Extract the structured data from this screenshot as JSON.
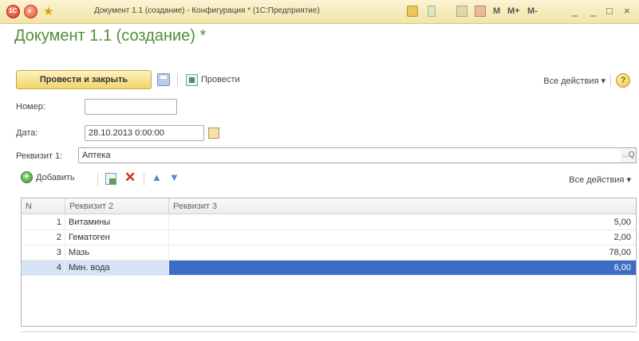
{
  "titlebar": {
    "title": "Документ 1.1 (создание) - Конфигурация * (1С:Предприятие)",
    "logo": "1С",
    "mem_buttons": [
      "M",
      "M+",
      "M-"
    ],
    "window_controls": [
      "_",
      "_",
      "□",
      "×"
    ]
  },
  "form": {
    "title": "Документ 1.1 (создание) *",
    "toolbar": {
      "post_close_label": "Провести и закрыть",
      "post_label": "Провести",
      "all_actions_label": "Все действия ▾",
      "help_label": "?"
    },
    "fields": {
      "number_label": "Номер:",
      "number_value": "",
      "date_label": "Дата:",
      "date_value": "28.10.2013  0:00:00",
      "req1_label": "Реквизит 1:",
      "req1_value": "Аптека",
      "req1_select": "...Q"
    }
  },
  "table": {
    "toolbar": {
      "add_label": "Добавить",
      "all_actions_label": "Все действия ▾"
    },
    "columns": [
      "N",
      "Реквизит 2",
      "Реквизит 3"
    ],
    "rows": [
      {
        "n": "1",
        "req2": "Витамины",
        "req3": "5,00"
      },
      {
        "n": "2",
        "req2": "Гематоген",
        "req3": "2,00"
      },
      {
        "n": "3",
        "req2": "Мазь",
        "req3": "78,00"
      },
      {
        "n": "4",
        "req2": "Мин. вода",
        "req3": "6,00",
        "selected": true
      }
    ]
  },
  "colors": {
    "title_green": "#4f8f3a",
    "primary_button": "#f2d46c",
    "selection": "#3d6cc3"
  }
}
